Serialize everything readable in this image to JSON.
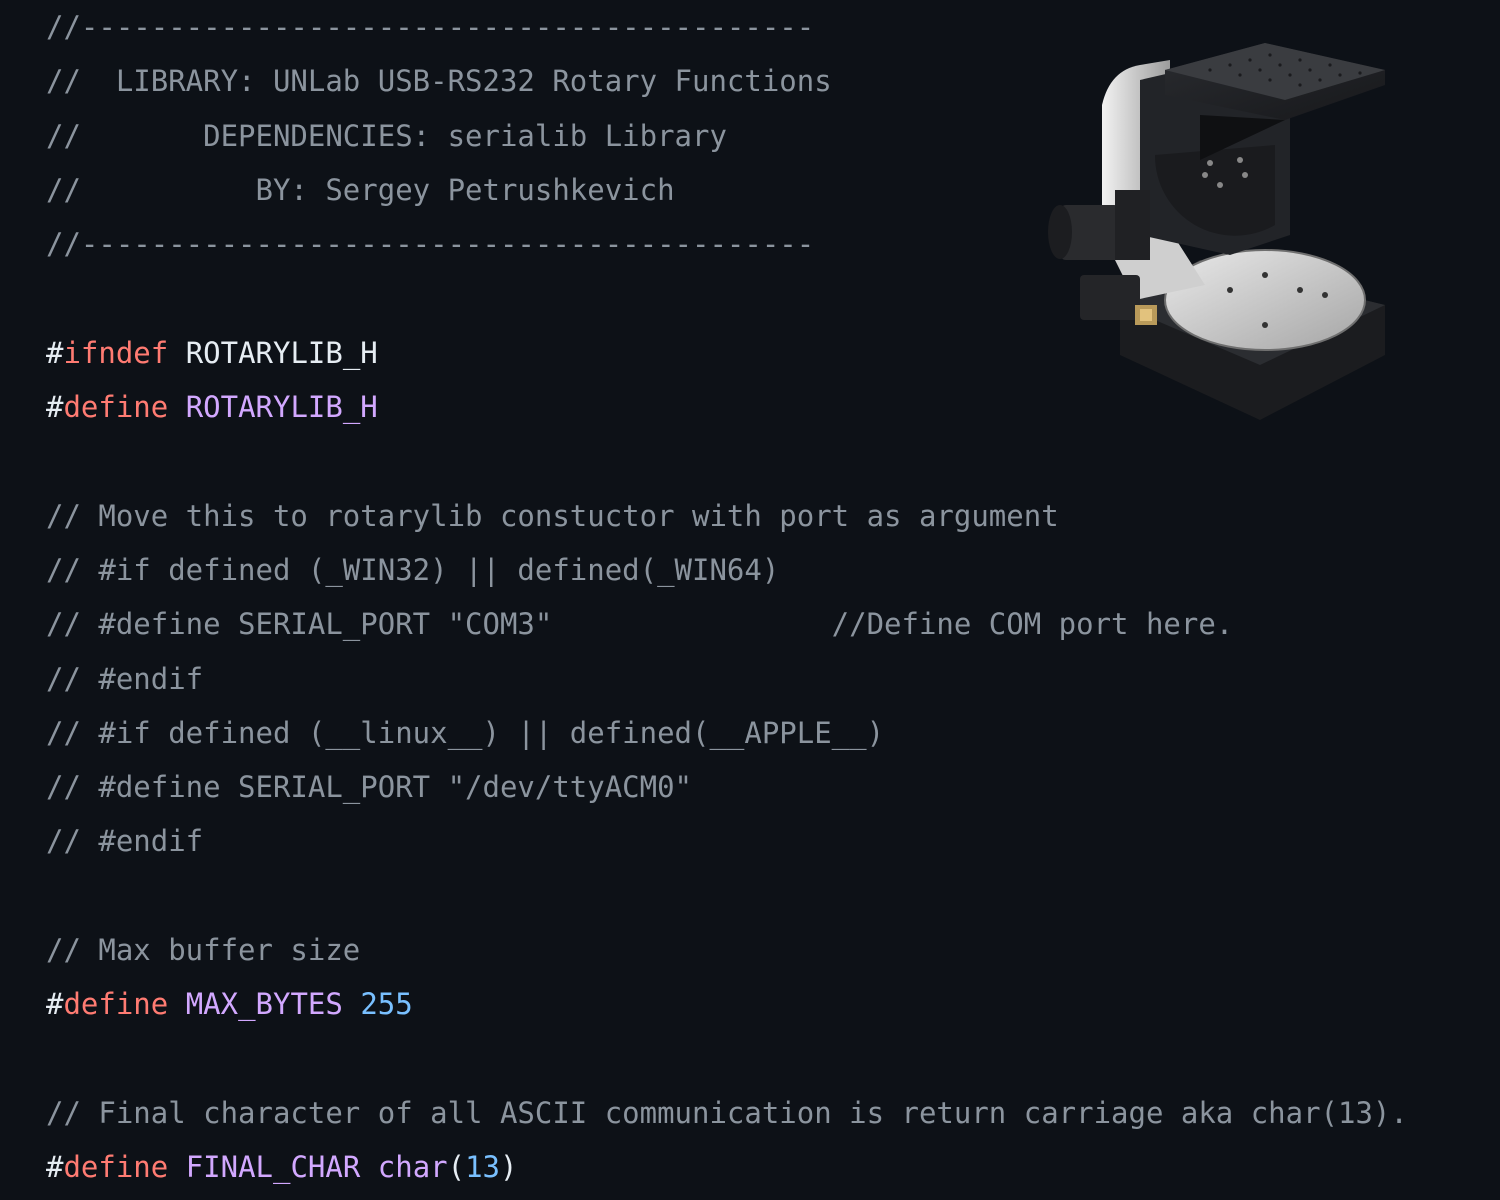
{
  "editor": {
    "lines": [
      {
        "type": "comment",
        "text": "//------------------------------------------"
      },
      {
        "type": "comment",
        "text": "//  LIBRARY: UNLab USB-RS232 Rotary Functions"
      },
      {
        "type": "comment",
        "text": "//       DEPENDENCIES: serialib Library"
      },
      {
        "type": "comment",
        "text": "//          BY: Sergey Petrushkevich"
      },
      {
        "type": "comment",
        "text": "//------------------------------------------"
      },
      {
        "type": "blank",
        "text": ""
      },
      {
        "type": "directive",
        "hash": "#",
        "keyword": "ifndef",
        "name": "ROTARYLIB_H",
        "name_style": "plain"
      },
      {
        "type": "directive",
        "hash": "#",
        "keyword": "define",
        "name": "ROTARYLIB_H",
        "name_style": "macro"
      },
      {
        "type": "blank",
        "text": ""
      },
      {
        "type": "comment",
        "text": "// Move this to rotarylib constuctor with port as argument"
      },
      {
        "type": "comment",
        "text": "// #if defined (_WIN32) || defined(_WIN64)"
      },
      {
        "type": "comment",
        "text": "// #define SERIAL_PORT \"COM3\"                //Define COM port here."
      },
      {
        "type": "comment",
        "text": "// #endif"
      },
      {
        "type": "comment",
        "text": "// #if defined (__linux__) || defined(__APPLE__)"
      },
      {
        "type": "comment",
        "text": "// #define SERIAL_PORT \"/dev/ttyACM0\""
      },
      {
        "type": "comment",
        "text": "// #endif"
      },
      {
        "type": "blank",
        "text": ""
      },
      {
        "type": "comment",
        "text": "// Max buffer size"
      },
      {
        "type": "directive",
        "hash": "#",
        "keyword": "define",
        "name": "MAX_BYTES",
        "name_style": "macro",
        "value": "255"
      },
      {
        "type": "blank",
        "text": ""
      },
      {
        "type": "comment",
        "text": "// Final character of all ASCII communication is return carriage aka char(13)."
      },
      {
        "type": "directive_call",
        "hash": "#",
        "keyword": "define",
        "name": "FINAL_CHAR",
        "func": "char",
        "open": "(",
        "arg": "13",
        "close": ")"
      }
    ]
  },
  "image": {
    "icon": "rotary-stage-render"
  },
  "colors": {
    "background": "#0d1117",
    "comment": "#8b949e",
    "keyword": "#ff7b72",
    "macro": "#d2a8ff",
    "number": "#79c0ff",
    "text": "#e6edf3"
  }
}
